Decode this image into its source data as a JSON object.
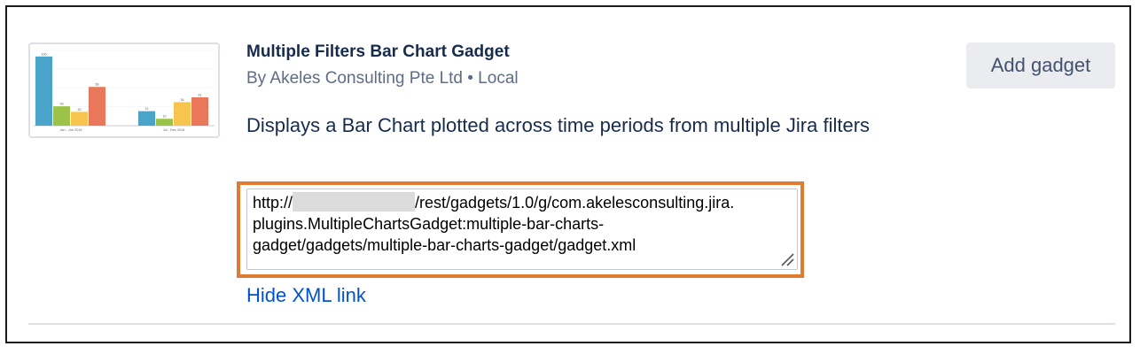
{
  "gadget": {
    "title": "Multiple Filters Bar Chart Gadget",
    "byline": "By Akeles Consulting Pte Ltd • Local",
    "description": "Displays a Bar Chart plotted across time periods from multiple Jira filters",
    "add_button_label": "Add gadget",
    "xml_url": {
      "prefix": "http://",
      "line1_rest": "/rest/gadgets/1.0/g/com.akelesconsulting.jira.",
      "line2": "plugins.MultipleChartsGadget:multiple-bar-charts-",
      "line3": "gadget/gadgets/multiple-bar-charts-gadget/gadget.xml"
    },
    "hide_link_label": "Hide XML link",
    "highlight_color": "#e07b32"
  },
  "thumbnail": {
    "chart_data": {
      "type": "bar",
      "categories": [
        "Jan - Jun 2016",
        "Jul - Dec 2016"
      ],
      "series": [
        {
          "values": [
            100,
            21
          ],
          "color": "#4aa3c8"
        },
        {
          "values": [
            28,
            10
          ],
          "color": "#9bc34a"
        },
        {
          "values": [
            20,
            34
          ],
          "color": "#f7c54e"
        },
        {
          "values": [
            56,
            41
          ],
          "color": "#e9775a"
        }
      ],
      "ylim": [
        0,
        110
      ]
    }
  }
}
